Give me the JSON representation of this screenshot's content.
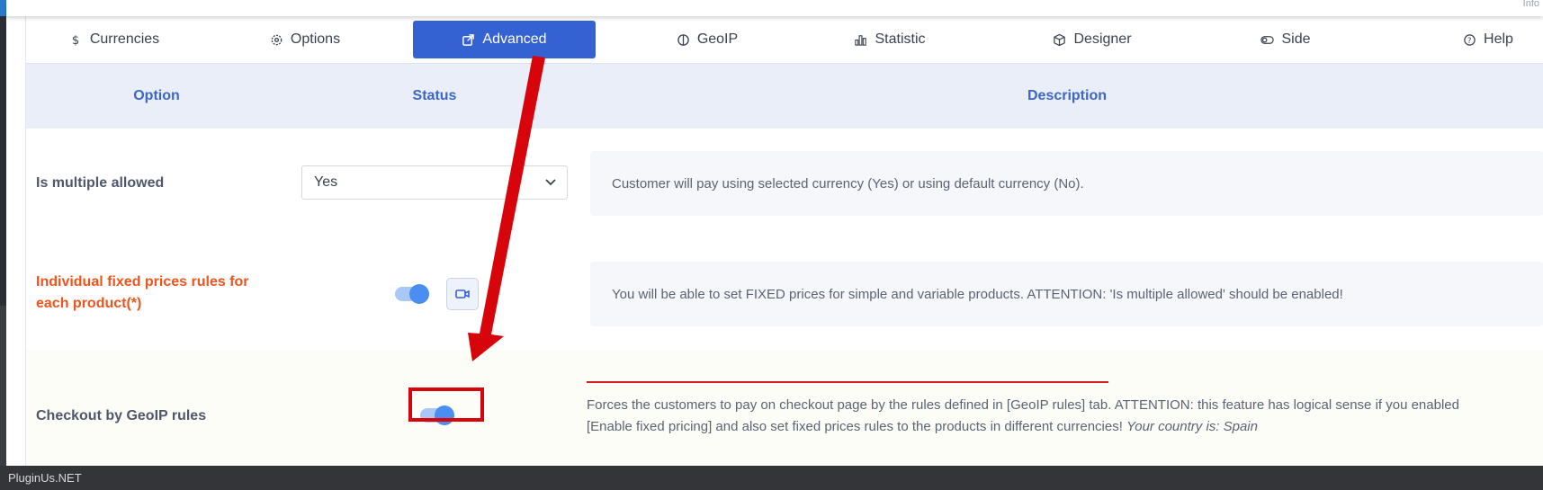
{
  "topbar": {
    "corner_text": "Info"
  },
  "tabs": [
    {
      "label": "Currencies",
      "icon": "dollar-icon"
    },
    {
      "label": "Options",
      "icon": "gear-icon"
    },
    {
      "label": "Advanced",
      "icon": "external-link-icon"
    },
    {
      "label": "GeoIP",
      "icon": "half-circle-icon"
    },
    {
      "label": "Statistic",
      "icon": "bar-chart-icon"
    },
    {
      "label": "Designer",
      "icon": "cube-icon"
    },
    {
      "label": "Side",
      "icon": "toggle-icon"
    },
    {
      "label": "Help",
      "icon": "help-circle-icon"
    }
  ],
  "active_tab": "Advanced",
  "table": {
    "headers": {
      "option": "Option",
      "status": "Status",
      "description": "Description"
    },
    "rows": [
      {
        "label": "Is multiple allowed",
        "select_value": "Yes",
        "description": "Customer will pay using selected currency (Yes) or using default currency (No)."
      },
      {
        "label": "Individual fixed prices rules for each product(*)",
        "toggle_on": true,
        "description": "You will be able to set FIXED prices for simple and variable products. ATTENTION: 'Is multiple allowed' should be enabled!"
      },
      {
        "label": "Checkout by GeoIP rules",
        "toggle_on": true,
        "description_main": "Forces the customers to pay on checkout page by the rules defined in [GeoIP rules] tab. ATTENTION: this feature has logical sense if you enabled [Enable fixed pricing] and also set fixed prices rules to the products in different currencies!",
        "description_country": "Your country is: Spain"
      }
    ]
  },
  "footer": {
    "text": "PluginUs.NET"
  },
  "colors": {
    "accent": "#3462d2",
    "header_bg": "#e9eef8",
    "orange_label": "#f0541c",
    "annotation_red": "#d8040b"
  }
}
